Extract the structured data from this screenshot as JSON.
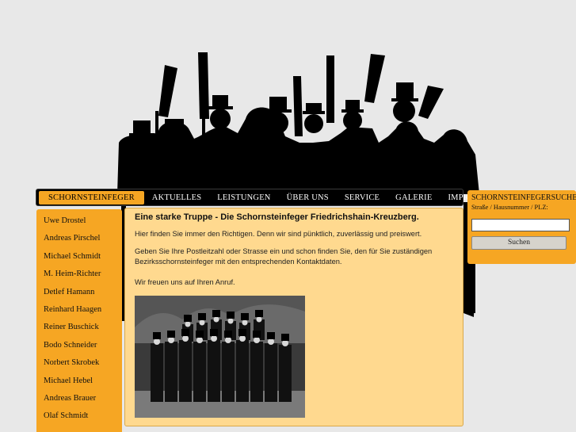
{
  "nav": {
    "items": [
      "SCHORNSTEINFEGER",
      "AKTUELLES",
      "LEISTUNGEN",
      "ÜBER UNS",
      "SERVICE",
      "GALERIE",
      "IMPRESSUM"
    ],
    "active": "SCHORNSTEINFEGER"
  },
  "sidebar": {
    "items": [
      "Uwe Drostel",
      "Andreas Pirschel",
      "Michael Schmidt",
      "M. Heim-Richter",
      "Detlef Hamann",
      "Reinhard Haagen",
      "Reiner Buschick",
      "Bodo Schneider",
      "Norbert Skrobek",
      "Michael Hebel",
      "Andreas Brauer",
      "Olaf Schmidt"
    ]
  },
  "content": {
    "title": "Eine starke Truppe - Die Schornsteinfeger Friedrichshain-Kreuzberg.",
    "p1": "Hier finden Sie immer den Richtigen. Denn wir sind pünktlich, zuverlässig und preiswert.",
    "p2": "Geben Sie Ihre Postleitzahl oder Strasse ein und schon finden Sie, den für Sie zuständigen Bezirksschornsteinfeger mit den entsprechenden Kontaktdaten.",
    "p3": "Wir freuen uns auf Ihren Anruf."
  },
  "search": {
    "title": "SCHORNSTEINFEGERSUCHE",
    "label": "Straße / Hausnummer / PLZ:",
    "value": "",
    "button": "Suchen"
  },
  "colors": {
    "accent": "#f6a623",
    "content_bg": "#ffd98f",
    "page_bg": "#e8e8e8",
    "nav_bg": "#000000"
  }
}
